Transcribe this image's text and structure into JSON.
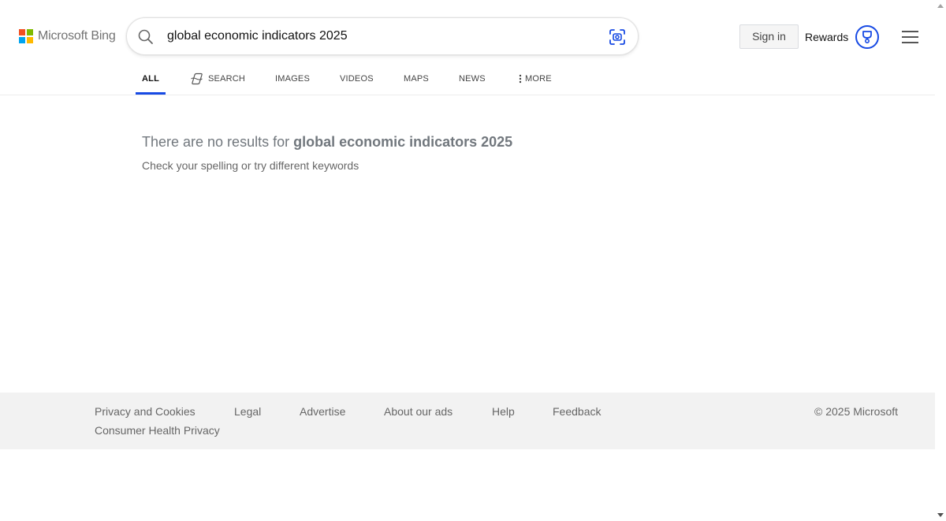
{
  "brand": {
    "logo_text": "Microsoft Bing",
    "square_colors": [
      "#f25022",
      "#7fba00",
      "#00a4ef",
      "#ffb900"
    ]
  },
  "search": {
    "query": "global economic indicators 2025",
    "search_icon": "search-icon",
    "visual_search_icon": "camera-search-icon"
  },
  "header": {
    "sign_in_label": "Sign in",
    "rewards_label": "Rewards",
    "rewards_icon": "trophy-icon",
    "menu_icon": "hamburger-menu-icon"
  },
  "tabs": [
    {
      "label": "ALL",
      "active": true
    },
    {
      "label": "SEARCH",
      "icon": "copilot-icon"
    },
    {
      "label": "IMAGES"
    },
    {
      "label": "VIDEOS"
    },
    {
      "label": "MAPS"
    },
    {
      "label": "NEWS"
    },
    {
      "label": "MORE",
      "icon": "vertical-dots-icon"
    }
  ],
  "results": {
    "no_results_prefix": "There are no results for ",
    "no_results_query": "global economic indicators 2025",
    "hint": "Check your spelling or try different keywords"
  },
  "footer": {
    "links": [
      "Privacy and Cookies",
      "Legal",
      "Advertise",
      "About our ads",
      "Help",
      "Feedback",
      "Consumer Health Privacy"
    ],
    "copyright": "© 2025 Microsoft"
  },
  "colors": {
    "accent": "#174ae4",
    "footer_bg": "#f2f2f2"
  }
}
